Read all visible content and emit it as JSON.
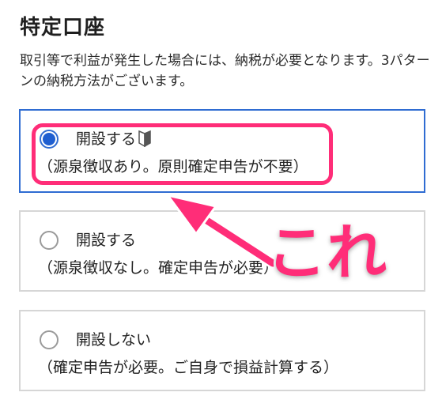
{
  "title": "特定口座",
  "description": "取引等で利益が発生した場合には、納税が必要となります。3パターンの納税方法がございます。",
  "options": [
    {
      "label": "開設する",
      "sub": "（源泉徴収あり。原則確定申告が不要）",
      "selected": true,
      "icon": "beginner-mark-icon"
    },
    {
      "label": "開設する",
      "sub": "（源泉徴収なし。確定申告が必要）",
      "selected": false
    },
    {
      "label": "開設しない",
      "sub": "（確定申告が必要。ご自身で損益計算する）",
      "selected": false
    }
  ],
  "annotation": {
    "text": "これ",
    "color": "#ff2d78"
  },
  "colors": {
    "accent": "#1f5fd0",
    "annotation": "#ff2d78",
    "border": "#d6d6d6"
  }
}
